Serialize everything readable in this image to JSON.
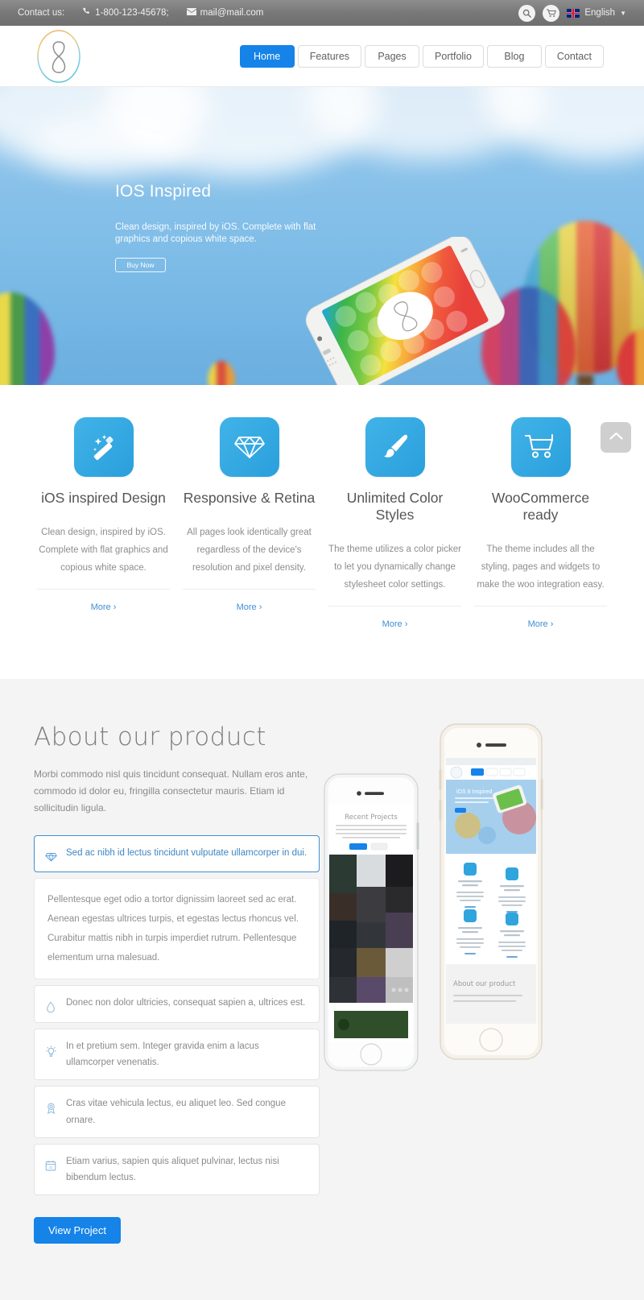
{
  "topbar": {
    "contact_label": "Contact us:",
    "phone": "1-800-123-45678;",
    "email": "mail@mail.com",
    "search_icon": "search-icon",
    "cart_icon": "cart-icon",
    "language": "English",
    "caret": "▼"
  },
  "header": {
    "logo_alt": "ios8-logo",
    "nav": [
      {
        "label": "Home",
        "active": true
      },
      {
        "label": "Features",
        "active": false
      },
      {
        "label": "Pages",
        "active": false
      },
      {
        "label": "Portfolio",
        "active": false
      },
      {
        "label": "Blog",
        "active": false
      },
      {
        "label": "Contact",
        "active": false
      }
    ]
  },
  "hero": {
    "title": "IOS Inspired",
    "subtitle": "Clean design, inspired by iOS. Complete with flat graphics and copious white space.",
    "button": "Buy Now"
  },
  "features": {
    "scroll_top_icon": "chevron-up-icon",
    "cards": [
      {
        "icon": "magic-wand-icon",
        "title": "iOS inspired Design",
        "desc": "Clean design, inspired by iOS. Complete with flat graphics and copious white space.",
        "more": "More ›"
      },
      {
        "icon": "diamond-icon",
        "title": "Responsive & Retina",
        "desc": "All pages look identically great regardless of the device's resolution and pixel density.",
        "more": "More ›"
      },
      {
        "icon": "paintbrush-icon",
        "title": "Unlimited Color Styles",
        "desc": "The theme utilizes a color picker to let you dynamically change stylesheet color settings.",
        "more": "More ›"
      },
      {
        "icon": "shopping-cart-icon",
        "title": "WooCommerce ready",
        "desc": "The theme includes all the styling, pages and widgets to make the woo integration easy.",
        "more": "More ›"
      }
    ]
  },
  "about": {
    "title": "About our product",
    "paragraph": "Morbi commodo nisl quis tincidunt consequat. Nullam eros ante, commodo id dolor eu, fringilla consectetur mauris. Etiam id sollicitudin ligula.",
    "accordion": [
      {
        "icon": "diamond-icon",
        "text": "Sed ac nibh id lectus tincidunt vulputate ullamcorper in dui.",
        "active": true
      },
      {
        "icon": "water-drop-icon",
        "text": "Donec non dolor ultricies, consequat sapien a, ultrices est.",
        "active": false
      },
      {
        "icon": "lightbulb-icon",
        "text": "In et pretium sem. Integer gravida enim a lacus ullamcorper venenatis.",
        "active": false
      },
      {
        "icon": "award-ribbon-icon",
        "text": "Cras vitae vehicula lectus, eu aliquet leo. Sed congue ornare.",
        "active": false
      },
      {
        "icon": "calendar-icon",
        "text": "Etiam varius, sapien quis aliquet pulvinar, lectus nisi bibendum lectus.",
        "active": false
      }
    ],
    "accordion_body": "Pellentesque eget odio a tortor dignissim laoreet sed ac erat. Aenean egestas ultrices turpis, et egestas lectus rhoncus vel. Curabitur mattis nibh in turpis imperdiet rutrum. Pellentesque elementum urna malesuad.",
    "button": "View Project",
    "phone_left_caption": "Recent Projects",
    "phone_right_caption": "About our product",
    "phone_right_hero": "iOS 8 Inspired"
  },
  "colors": {
    "accent_blue": "#1583e8",
    "icon_blue": "#2a9fdc",
    "link_blue": "#3d8fd6",
    "topbar_gray": "#787878",
    "about_bg": "#f4f4f4"
  }
}
